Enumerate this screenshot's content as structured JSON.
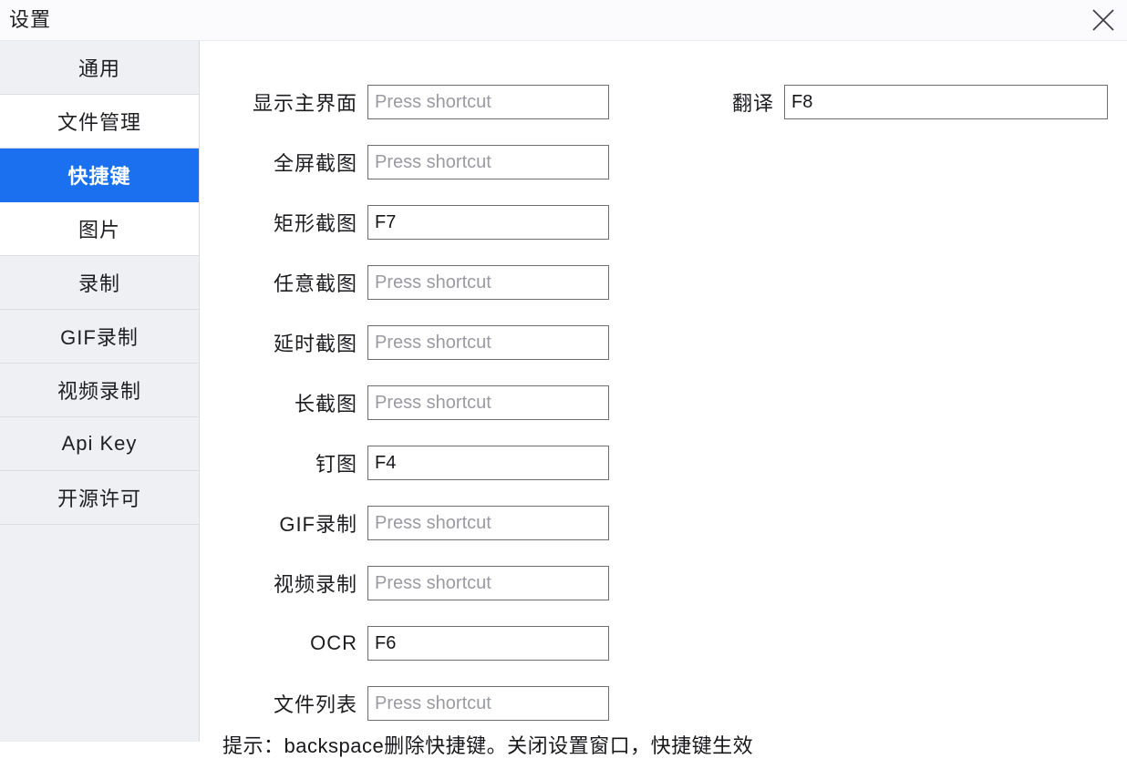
{
  "window": {
    "title": "设置",
    "close_icon": "close-icon"
  },
  "sidebar": {
    "items": [
      {
        "label": "通用",
        "selected": false
      },
      {
        "label": "文件管理",
        "selected": false
      },
      {
        "label": "快捷键",
        "selected": true
      },
      {
        "label": "图片",
        "selected": false
      },
      {
        "label": "录制",
        "selected": false
      },
      {
        "label": "GIF录制",
        "selected": false
      },
      {
        "label": "视频录制",
        "selected": false
      },
      {
        "label": "Api Key",
        "selected": false
      },
      {
        "label": "开源许可",
        "selected": false
      }
    ],
    "selected_bg": "#1a70ee"
  },
  "main": {
    "placeholder": "Press shortcut",
    "shortcuts": [
      {
        "label": "显示主界面",
        "value": ""
      },
      {
        "label": "全屏截图",
        "value": ""
      },
      {
        "label": "矩形截图",
        "value": "F7"
      },
      {
        "label": "任意截图",
        "value": ""
      },
      {
        "label": "延时截图",
        "value": ""
      },
      {
        "label": "长截图",
        "value": ""
      },
      {
        "label": "钉图",
        "value": "F4"
      },
      {
        "label": "GIF录制",
        "value": ""
      },
      {
        "label": "视频录制",
        "value": ""
      },
      {
        "label": "OCR",
        "value": "F6"
      },
      {
        "label": "文件列表",
        "value": ""
      }
    ],
    "translate": {
      "label": "翻译",
      "value": "F8"
    },
    "hint": "提示：backspace删除快捷键。关闭设置窗口，快捷键生效"
  }
}
